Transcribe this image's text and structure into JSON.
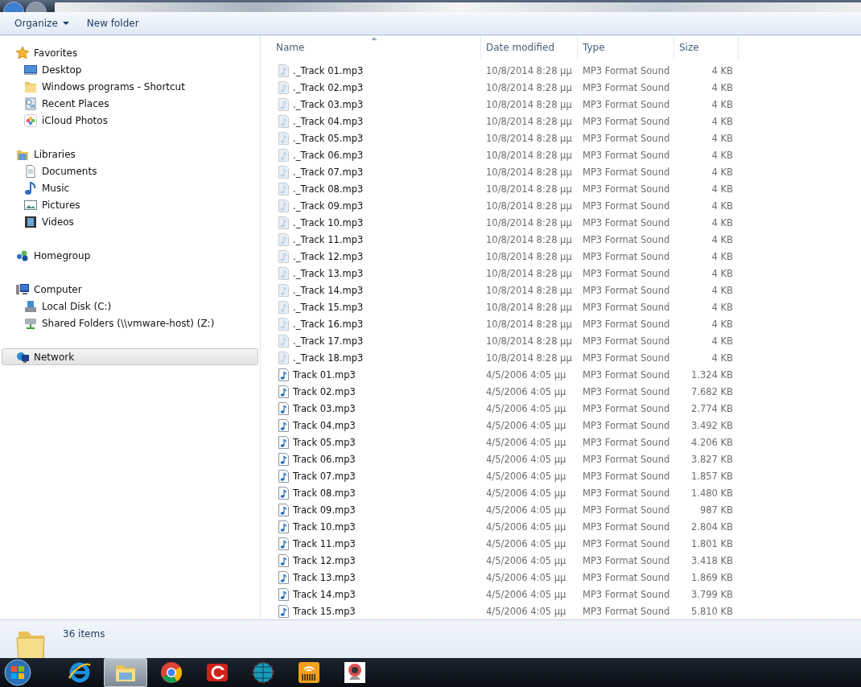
{
  "toolbar": {
    "buttons": [
      {
        "label": "Organize",
        "dropdown": true
      },
      {
        "label": "New folder",
        "dropdown": false
      }
    ]
  },
  "sidebar": {
    "groups": [
      {
        "label": "Favorites",
        "kind": "star",
        "selected": false,
        "children": [
          {
            "label": "Desktop",
            "kind": "desktop",
            "selected": false
          },
          {
            "label": "Windows programs - Shortcut",
            "kind": "folder",
            "selected": false
          },
          {
            "label": "Recent Places",
            "kind": "recent",
            "selected": false
          },
          {
            "label": "iCloud Photos",
            "kind": "photos",
            "selected": false
          }
        ]
      },
      {
        "label": "Libraries",
        "kind": "library",
        "selected": false,
        "children": [
          {
            "label": "Documents",
            "kind": "document",
            "selected": false
          },
          {
            "label": "Music",
            "kind": "music",
            "selected": false
          },
          {
            "label": "Pictures",
            "kind": "pictures",
            "selected": false
          },
          {
            "label": "Videos",
            "kind": "videos",
            "selected": false
          }
        ]
      },
      {
        "label": "Homegroup",
        "kind": "homegroup",
        "selected": false
      },
      {
        "label": "Computer",
        "kind": "computer",
        "selected": false,
        "children": [
          {
            "label": "Local Disk (C:)",
            "kind": "disk",
            "selected": false
          },
          {
            "label": "Shared Folders (\\\\vmware-host) (Z:)",
            "kind": "netdrive",
            "selected": false
          }
        ]
      },
      {
        "label": "Network",
        "kind": "network",
        "selected": true
      }
    ]
  },
  "table": {
    "columns": [
      {
        "label": "Name",
        "sorted": true
      },
      {
        "label": "Date modified",
        "sorted": false
      },
      {
        "label": "Type",
        "sorted": false
      },
      {
        "label": "Size",
        "sorted": false
      }
    ],
    "rows": [
      {
        "kind": "hidden",
        "name": "._Track 01.mp3",
        "date": "10/8/2014 8:28 μμ",
        "type": "MP3 Format Sound",
        "size": "4 KB"
      },
      {
        "kind": "hidden",
        "name": "._Track 02.mp3",
        "date": "10/8/2014 8:28 μμ",
        "type": "MP3 Format Sound",
        "size": "4 KB"
      },
      {
        "kind": "hidden",
        "name": "._Track 03.mp3",
        "date": "10/8/2014 8:28 μμ",
        "type": "MP3 Format Sound",
        "size": "4 KB"
      },
      {
        "kind": "hidden",
        "name": "._Track 04.mp3",
        "date": "10/8/2014 8:28 μμ",
        "type": "MP3 Format Sound",
        "size": "4 KB"
      },
      {
        "kind": "hidden",
        "name": "._Track 05.mp3",
        "date": "10/8/2014 8:28 μμ",
        "type": "MP3 Format Sound",
        "size": "4 KB"
      },
      {
        "kind": "hidden",
        "name": "._Track 06.mp3",
        "date": "10/8/2014 8:28 μμ",
        "type": "MP3 Format Sound",
        "size": "4 KB"
      },
      {
        "kind": "hidden",
        "name": "._Track 07.mp3",
        "date": "10/8/2014 8:28 μμ",
        "type": "MP3 Format Sound",
        "size": "4 KB"
      },
      {
        "kind": "hidden",
        "name": "._Track 08.mp3",
        "date": "10/8/2014 8:28 μμ",
        "type": "MP3 Format Sound",
        "size": "4 KB"
      },
      {
        "kind": "hidden",
        "name": "._Track 09.mp3",
        "date": "10/8/2014 8:28 μμ",
        "type": "MP3 Format Sound",
        "size": "4 KB"
      },
      {
        "kind": "hidden",
        "name": "._Track 10.mp3",
        "date": "10/8/2014 8:28 μμ",
        "type": "MP3 Format Sound",
        "size": "4 KB"
      },
      {
        "kind": "hidden",
        "name": "._Track 11.mp3",
        "date": "10/8/2014 8:28 μμ",
        "type": "MP3 Format Sound",
        "size": "4 KB"
      },
      {
        "kind": "hidden",
        "name": "._Track 12.mp3",
        "date": "10/8/2014 8:28 μμ",
        "type": "MP3 Format Sound",
        "size": "4 KB"
      },
      {
        "kind": "hidden",
        "name": "._Track 13.mp3",
        "date": "10/8/2014 8:28 μμ",
        "type": "MP3 Format Sound",
        "size": "4 KB"
      },
      {
        "kind": "hidden",
        "name": "._Track 14.mp3",
        "date": "10/8/2014 8:28 μμ",
        "type": "MP3 Format Sound",
        "size": "4 KB"
      },
      {
        "kind": "hidden",
        "name": "._Track 15.mp3",
        "date": "10/8/2014 8:28 μμ",
        "type": "MP3 Format Sound",
        "size": "4 KB"
      },
      {
        "kind": "hidden",
        "name": "._Track 16.mp3",
        "date": "10/8/2014 8:28 μμ",
        "type": "MP3 Format Sound",
        "size": "4 KB"
      },
      {
        "kind": "hidden",
        "name": "._Track 17.mp3",
        "date": "10/8/2014 8:28 μμ",
        "type": "MP3 Format Sound",
        "size": "4 KB"
      },
      {
        "kind": "hidden",
        "name": "._Track 18.mp3",
        "date": "10/8/2014 8:28 μμ",
        "type": "MP3 Format Sound",
        "size": "4 KB"
      },
      {
        "kind": "normal",
        "name": "Track 01.mp3",
        "date": "4/5/2006 4:05 μμ",
        "type": "MP3 Format Sound",
        "size": "1.324 KB"
      },
      {
        "kind": "normal",
        "name": "Track 02.mp3",
        "date": "4/5/2006 4:05 μμ",
        "type": "MP3 Format Sound",
        "size": "7.682 KB"
      },
      {
        "kind": "normal",
        "name": "Track 03.mp3",
        "date": "4/5/2006 4:05 μμ",
        "type": "MP3 Format Sound",
        "size": "2.774 KB"
      },
      {
        "kind": "normal",
        "name": "Track 04.mp3",
        "date": "4/5/2006 4:05 μμ",
        "type": "MP3 Format Sound",
        "size": "3.492 KB"
      },
      {
        "kind": "normal",
        "name": "Track 05.mp3",
        "date": "4/5/2006 4:05 μμ",
        "type": "MP3 Format Sound",
        "size": "4.206 KB"
      },
      {
        "kind": "normal",
        "name": "Track 06.mp3",
        "date": "4/5/2006 4:05 μμ",
        "type": "MP3 Format Sound",
        "size": "3.827 KB"
      },
      {
        "kind": "normal",
        "name": "Track 07.mp3",
        "date": "4/5/2006 4:05 μμ",
        "type": "MP3 Format Sound",
        "size": "1.857 KB"
      },
      {
        "kind": "normal",
        "name": "Track 08.mp3",
        "date": "4/5/2006 4:05 μμ",
        "type": "MP3 Format Sound",
        "size": "1.480 KB"
      },
      {
        "kind": "normal",
        "name": "Track 09.mp3",
        "date": "4/5/2006 4:05 μμ",
        "type": "MP3 Format Sound",
        "size": "987 KB"
      },
      {
        "kind": "normal",
        "name": "Track 10.mp3",
        "date": "4/5/2006 4:05 μμ",
        "type": "MP3 Format Sound",
        "size": "2.804 KB"
      },
      {
        "kind": "normal",
        "name": "Track 11.mp3",
        "date": "4/5/2006 4:05 μμ",
        "type": "MP3 Format Sound",
        "size": "1.801 KB"
      },
      {
        "kind": "normal",
        "name": "Track 12.mp3",
        "date": "4/5/2006 4:05 μμ",
        "type": "MP3 Format Sound",
        "size": "3.418 KB"
      },
      {
        "kind": "normal",
        "name": "Track 13.mp3",
        "date": "4/5/2006 4:05 μμ",
        "type": "MP3 Format Sound",
        "size": "1.869 KB"
      },
      {
        "kind": "normal",
        "name": "Track 14.mp3",
        "date": "4/5/2006 4:05 μμ",
        "type": "MP3 Format Sound",
        "size": "3.799 KB"
      },
      {
        "kind": "normal",
        "name": "Track 15.mp3",
        "date": "4/5/2006 4:05 μμ",
        "type": "MP3 Format Sound",
        "size": "5.810 KB"
      }
    ]
  },
  "status_bar": {
    "count": "36 items"
  },
  "taskbar": {
    "items": [
      {
        "kind": "browser-e",
        "selected": false
      },
      {
        "kind": "explorer",
        "selected": true
      },
      {
        "kind": "chrome",
        "selected": false
      },
      {
        "kind": "red-c",
        "selected": false
      },
      {
        "kind": "globe",
        "selected": false
      },
      {
        "kind": "barcode",
        "selected": false
      },
      {
        "kind": "webcam",
        "selected": false
      }
    ]
  }
}
